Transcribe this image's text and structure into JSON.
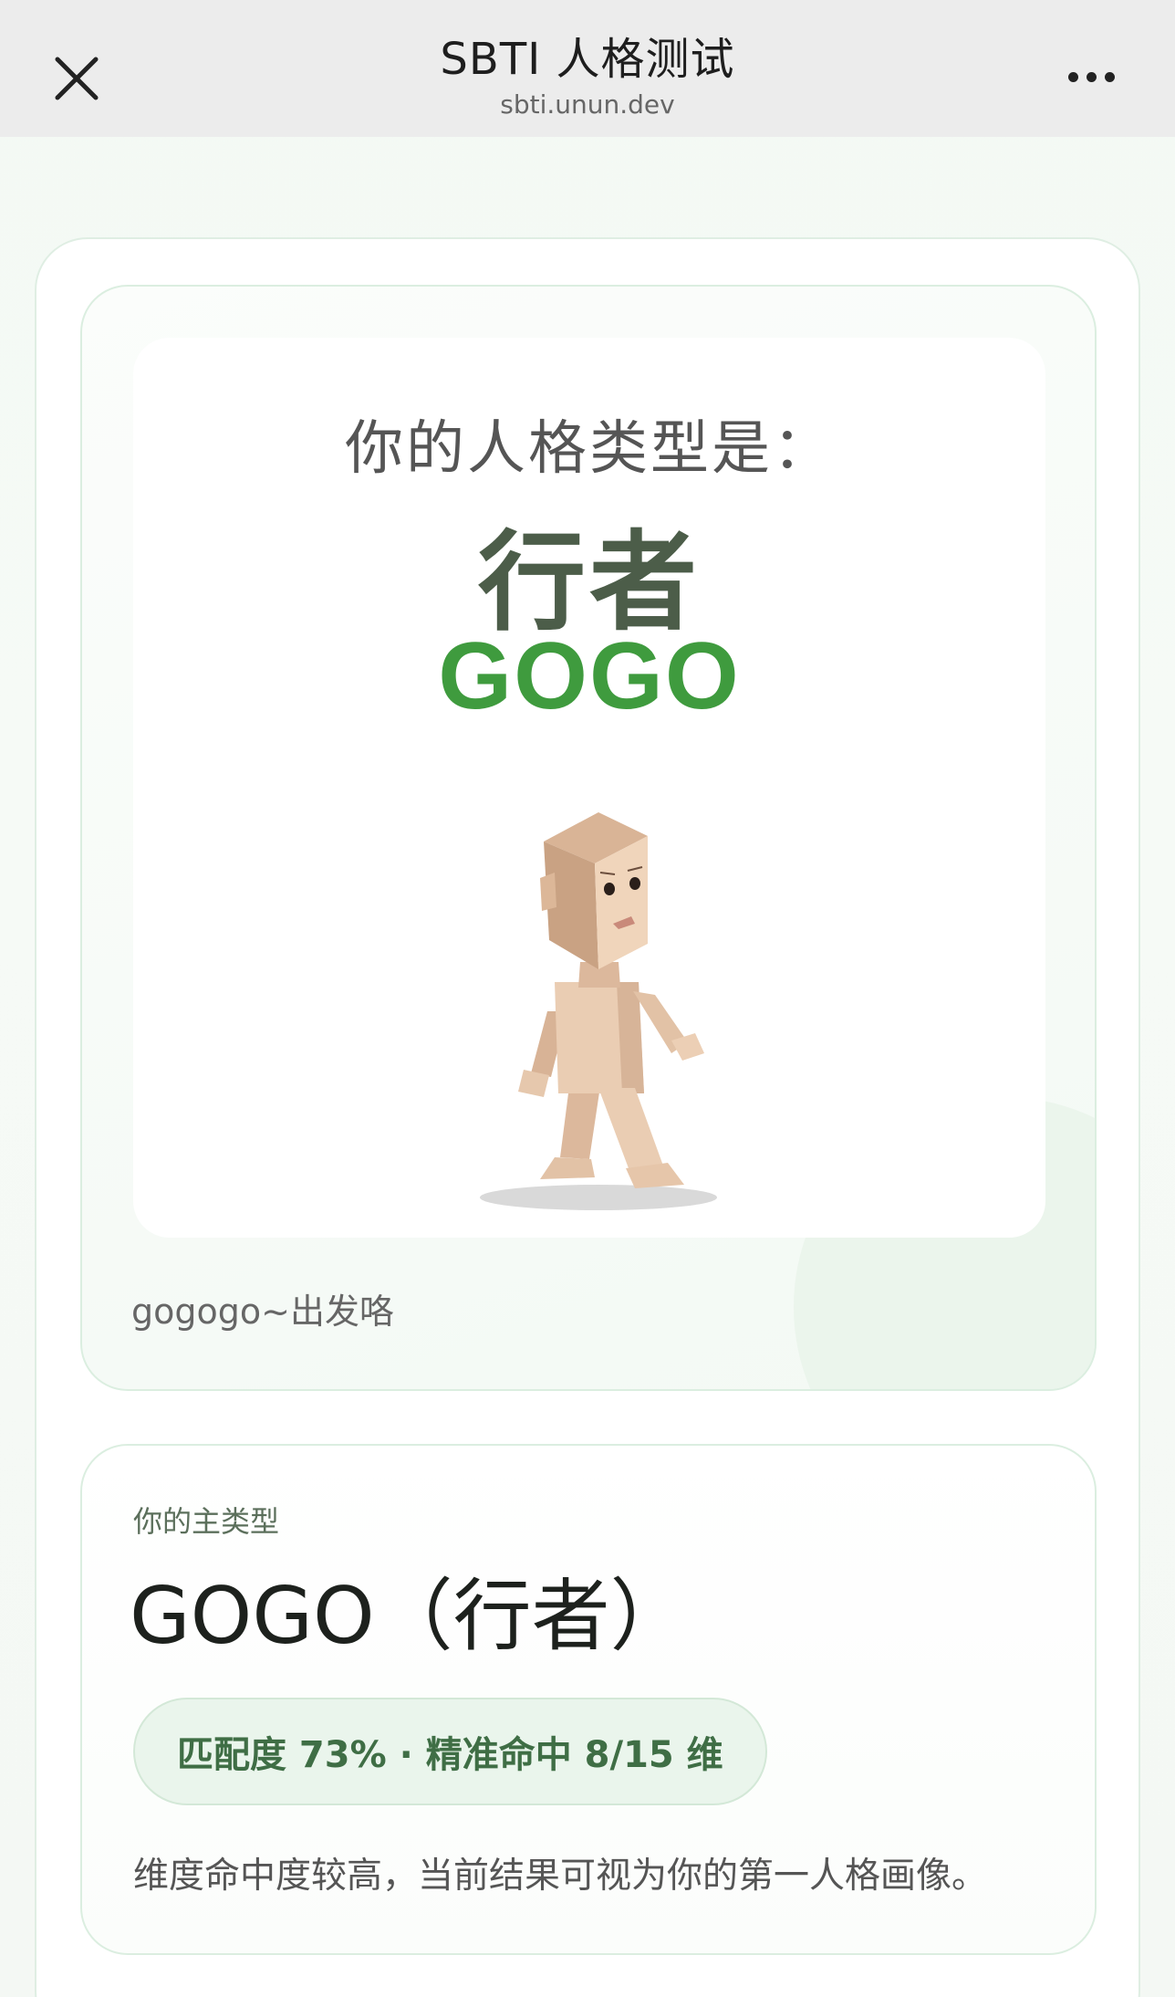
{
  "header": {
    "title": "SBTI 人格测试",
    "url": "sbti.unun.dev"
  },
  "poster": {
    "heading": "你的人格类型是：",
    "name_cn": "行者",
    "code": "GOGO",
    "caption": "gogogo~出发咯"
  },
  "main_type": {
    "label": "你的主类型",
    "value": "GOGO（行者）",
    "match": "匹配度 73% · 精准命中 8/15 维",
    "description": "维度命中度较高，当前结果可视为你的第一人格画像。"
  },
  "icons": [
    "close-icon",
    "more-icon",
    "walking-character-illustration"
  ],
  "colors": {
    "accent_green": "#3f9b3e",
    "badge_bg": "#eaf5ec",
    "badge_text": "#3f6e45"
  }
}
